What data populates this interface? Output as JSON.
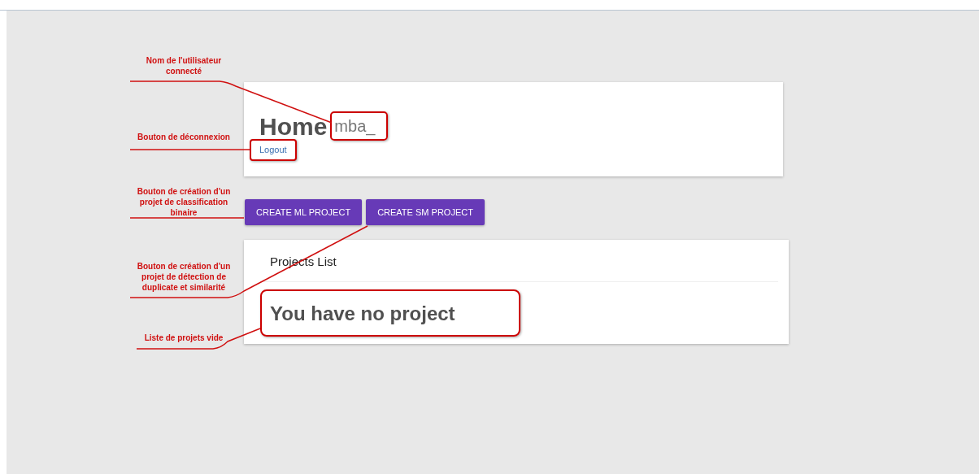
{
  "home": {
    "title": "Home",
    "username": "mba_",
    "logout": "Logout"
  },
  "actions": [
    {
      "label": "CREATE ML PROJECT"
    },
    {
      "label": "CREATE SM PROJECT"
    }
  ],
  "projects": {
    "title": "Projects List",
    "empty_message": "You have no project"
  },
  "annotations": [
    {
      "text": "Nom de l'utilisateur connecté"
    },
    {
      "text": "Bouton de déconnexion"
    },
    {
      "text": "Bouton de création d'un projet de classification binaire"
    },
    {
      "text": "Bouton de création d'un projet de détection de duplicate et similarité"
    },
    {
      "text": "Liste de projets vide"
    }
  ]
}
